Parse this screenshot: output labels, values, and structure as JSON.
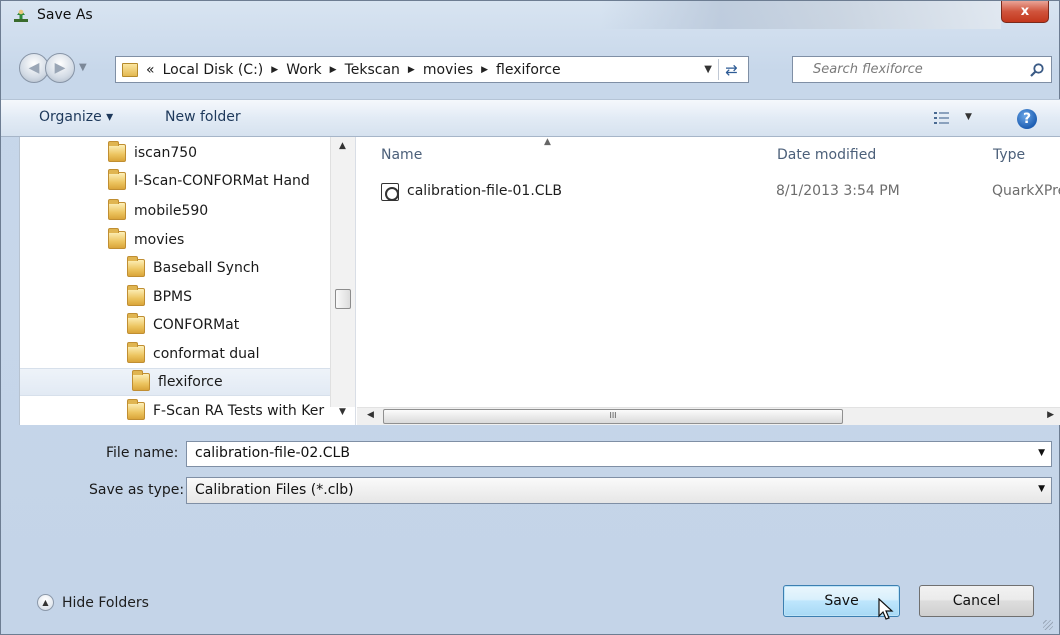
{
  "window": {
    "title": "Save As",
    "close_label": "x"
  },
  "navigation": {
    "breadcrumbs": [
      {
        "label": "Local Disk (C:)"
      },
      {
        "label": "Work"
      },
      {
        "label": "Tekscan"
      },
      {
        "label": "movies"
      },
      {
        "label": "flexiforce"
      }
    ],
    "overflow_label": "«",
    "search_placeholder": "Search flexiforce"
  },
  "toolbar": {
    "organize_label": "Organize ▾",
    "new_folder_label": "New folder",
    "help_label": "?"
  },
  "folder_tree": {
    "items": [
      {
        "label": "iscan750",
        "level": 0,
        "selected": false
      },
      {
        "label": "I-Scan-CONFORMat Hand",
        "level": 0,
        "selected": false
      },
      {
        "label": "mobile590",
        "level": 0,
        "selected": false
      },
      {
        "label": "movies",
        "level": 0,
        "selected": false
      },
      {
        "label": "Baseball Synch",
        "level": 1,
        "selected": false
      },
      {
        "label": "BPMS",
        "level": 1,
        "selected": false
      },
      {
        "label": "CONFORMat",
        "level": 1,
        "selected": false
      },
      {
        "label": "conformat dual",
        "level": 1,
        "selected": false
      },
      {
        "label": "flexiforce",
        "level": 1,
        "selected": true
      },
      {
        "label": "F-Scan RA Tests with Ker",
        "level": 1,
        "selected": false
      }
    ]
  },
  "file_list": {
    "columns": {
      "name": "Name",
      "date_modified": "Date modified",
      "type": "Type"
    },
    "rows": [
      {
        "name": "calibration-file-01.CLB",
        "date_modified": "8/1/2013 3:54 PM",
        "type": "QuarkXPress"
      }
    ],
    "scroll_grip": "III"
  },
  "form": {
    "file_name_label": "File name:",
    "file_name_value": "calibration-file-02.CLB",
    "save_type_label": "Save as type:",
    "save_type_value": "Calibration Files (*.clb)"
  },
  "footer": {
    "hide_folders_label": "Hide Folders",
    "save_label": "Save",
    "cancel_label": "Cancel"
  },
  "colors": {
    "accent": "#3c7fb1",
    "close_button": "#c3371c",
    "folder": "#ecc45f"
  }
}
